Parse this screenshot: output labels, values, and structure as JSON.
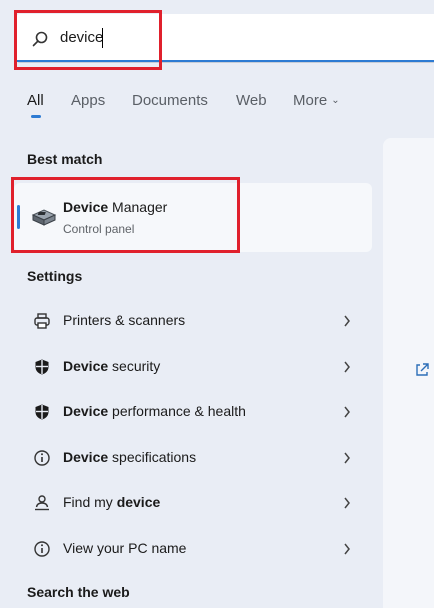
{
  "search": {
    "query": "device"
  },
  "tabs": [
    {
      "label": "All",
      "active": true
    },
    {
      "label": "Apps"
    },
    {
      "label": "Documents"
    },
    {
      "label": "Web"
    },
    {
      "label": "More"
    }
  ],
  "best_match": {
    "section_title": "Best match",
    "title_bold": "Device",
    "title_rest": " Manager",
    "subtitle": "Control panel"
  },
  "settings": {
    "section_title": "Settings",
    "items": [
      {
        "pre": "",
        "bold": "",
        "post": "Printers & scanners",
        "icon": "printer-icon"
      },
      {
        "pre": "",
        "bold": "Device",
        "post": " security",
        "icon": "shield-icon"
      },
      {
        "pre": "",
        "bold": "Device",
        "post": " performance & health",
        "icon": "shield-icon"
      },
      {
        "pre": "",
        "bold": "Device",
        "post": " specifications",
        "icon": "info-icon"
      },
      {
        "pre": "Find my ",
        "bold": "device",
        "post": "",
        "icon": "person-location-icon"
      },
      {
        "pre": "",
        "bold": "",
        "post": "View your PC name",
        "icon": "info-icon"
      }
    ]
  },
  "search_web": {
    "section_title": "Search the web"
  },
  "colors": {
    "accent": "#2d7bd3",
    "annotation": "#e0202c"
  }
}
